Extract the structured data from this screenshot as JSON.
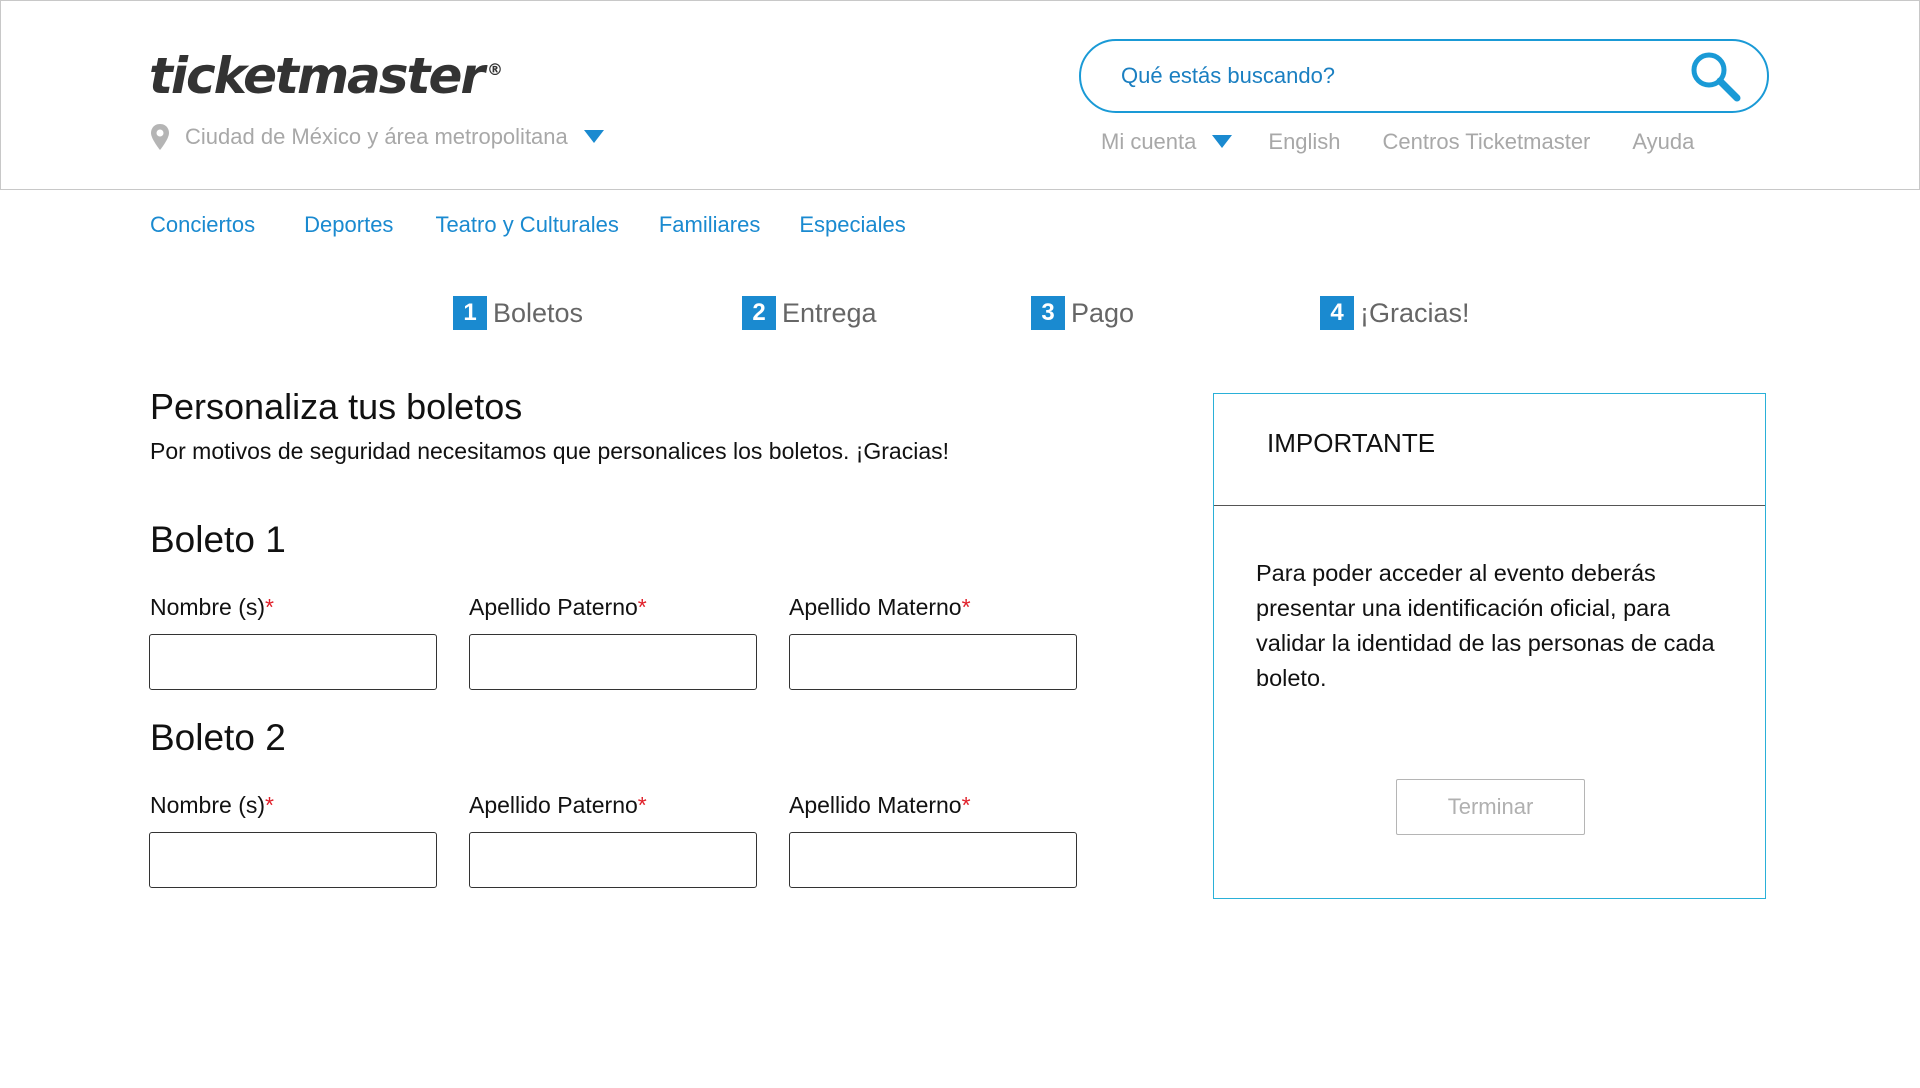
{
  "header": {
    "logo": "ticketmaster",
    "logo_mark": "®",
    "location": "Ciudad de México y área metropolitana",
    "search_placeholder": "Qué estás buscando?",
    "links": {
      "account": "Mi cuenta",
      "english": "English",
      "centers": "Centros Ticketmaster",
      "help": "Ayuda"
    }
  },
  "categories": [
    "Conciertos",
    "Deportes",
    "Teatro y Culturales",
    "Familiares",
    "Especiales"
  ],
  "steps": [
    {
      "num": "1",
      "label": "Boletos"
    },
    {
      "num": "2",
      "label": "Entrega"
    },
    {
      "num": "3",
      "label": "Pago"
    },
    {
      "num": "4",
      "label": "¡Gracias!"
    }
  ],
  "main": {
    "title": "Personaliza tus boletos",
    "subtitle": "Por motivos de seguridad necesitamos que personalices los boletos. ¡Gracias!",
    "required_mark": "*",
    "tickets": [
      {
        "title": "Boleto 1",
        "fields": [
          "Nombre (s)",
          "Apellido Paterno",
          "Apellido Materno"
        ]
      },
      {
        "title": "Boleto 2",
        "fields": [
          "Nombre (s)",
          "Apellido Paterno",
          "Apellido Materno"
        ]
      }
    ]
  },
  "panel": {
    "title": "IMPORTANTE",
    "body": "Para poder acceder al evento deberás presentar una identificación oficial, para validar la identidad de las personas de cada boleto.",
    "button": "Terminar"
  },
  "colors": {
    "accent": "#1a8ad0",
    "panel_border": "#2ab0d8",
    "required": "#e0202a",
    "muted": "#a8a8a8"
  }
}
